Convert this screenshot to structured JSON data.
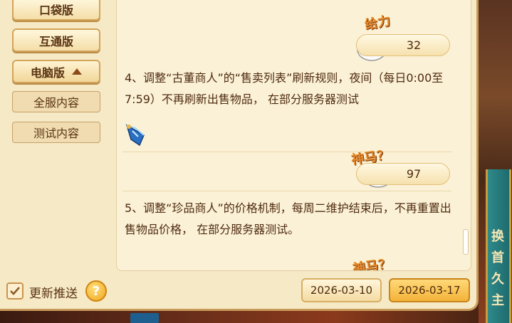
{
  "sidebar": {
    "categories": [
      {
        "label": "口袋版"
      },
      {
        "label": "互通版"
      },
      {
        "label": "电脑版"
      }
    ],
    "subcategories": [
      {
        "label": "全服内容"
      },
      {
        "label": "测试内容"
      }
    ]
  },
  "news": [
    {
      "text": "4、调整“古董商人”的“售卖列表”刷新规则，夜间（每日0:00至7:59）不再刷新出售物品， 在部分服务器测试",
      "rating_label": "给力",
      "rating_count": "32"
    },
    {
      "text": "5、调整“珍品商人”的价格机制，每周二维护结束后，不再重置出售物品价格， 在部分服务器测试。",
      "rating_label": "神马？",
      "rating_count": "97"
    },
    {
      "rating_label": "神马？"
    }
  ],
  "footer": {
    "push_label": "更新推送",
    "push_checked": true,
    "help_symbol": "?",
    "dates": [
      "2026-03-10",
      "2026-03-17"
    ]
  },
  "background": {
    "vertical_text": "换首久主"
  },
  "colors": {
    "parchment": "#f6e9c6",
    "text_brown": "#4e2b10",
    "accent_gold": "#f4b33a"
  }
}
